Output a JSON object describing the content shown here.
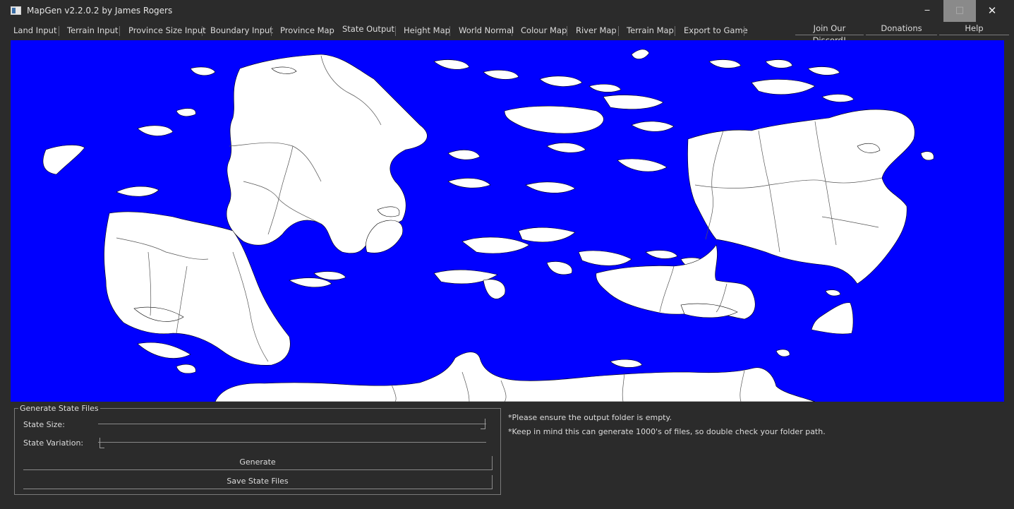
{
  "window": {
    "title": "MapGen v2.2.0.2 by James Rogers",
    "minimize": "‒",
    "maximize": "□",
    "close": "✕"
  },
  "tabs": [
    {
      "label": "Land Input"
    },
    {
      "label": "Terrain Input"
    },
    {
      "label": "Province Size Input"
    },
    {
      "label": "Boundary Input"
    },
    {
      "label": "Province Map"
    },
    {
      "label": "State Output"
    },
    {
      "label": "Height Map"
    },
    {
      "label": "World Normal"
    },
    {
      "label": "Colour Map"
    },
    {
      "label": "River Map"
    },
    {
      "label": "Terrain Map"
    },
    {
      "label": "Export to Game"
    }
  ],
  "active_tab": "State Output",
  "right_buttons": {
    "discord": "Join Our Discord!",
    "donations": "Donations",
    "help": "Help"
  },
  "map": {
    "water_color": "#0000ff",
    "land_color": "#ffffff",
    "border_color": "#555555"
  },
  "panel": {
    "group_title": "Generate State Files",
    "state_size_label": "State Size:",
    "state_size_value": 1.0,
    "state_variation_label": "State Variation:",
    "state_variation_value": 0.0,
    "generate_label": "Generate",
    "save_label": "Save State Files"
  },
  "notes": {
    "line1": "*Please ensure the output folder is empty.",
    "line2": "*Keep in mind this can generate 1000's of files, so double check your folder path."
  }
}
